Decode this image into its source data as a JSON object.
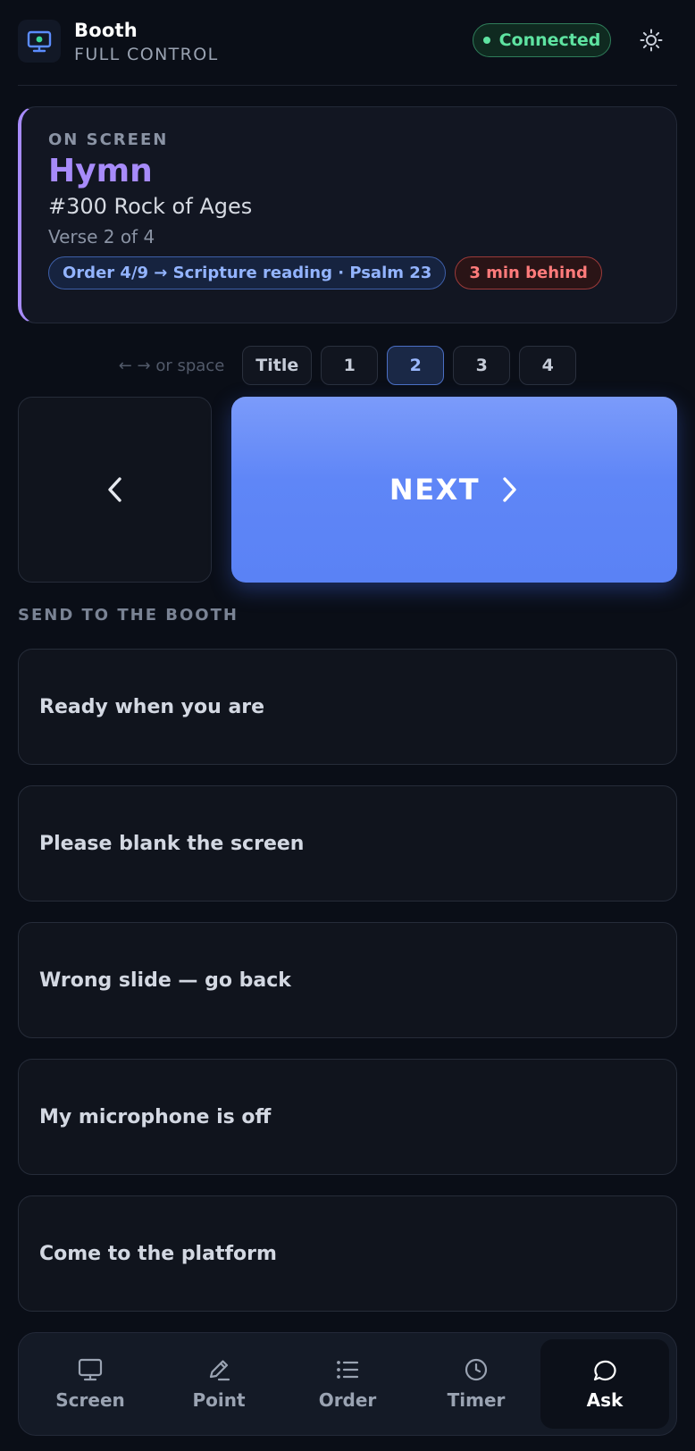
{
  "header": {
    "title": "Booth",
    "subtitle": "FULL CONTROL",
    "status": "Connected",
    "colors": {
      "status": "#5ee3a1",
      "accent": "#a78bfa"
    }
  },
  "on_screen": {
    "kicker": "ON SCREEN",
    "type": "Hymn",
    "song": "#300 Rock of Ages",
    "verse": "Verse 2 of 4",
    "order_tag": "Order 4/9 → Scripture reading · Psalm 23",
    "behind_tag": "3 min behind"
  },
  "verse_nav": {
    "hint": "← → or space",
    "items": [
      "Title",
      "1",
      "2",
      "3",
      "4"
    ],
    "active": "2"
  },
  "controls": {
    "next_label": "NEXT",
    "prev_icon": "chevron-left-icon",
    "next_icon": "chevron-right-icon"
  },
  "send_to_booth": {
    "label": "SEND TO THE BOOTH",
    "messages": [
      "Ready when you are",
      "Please blank the screen",
      "Wrong slide — go back",
      "My microphone is off",
      "Come to the platform"
    ]
  },
  "bottom_nav": {
    "items": [
      {
        "label": "Screen",
        "icon": "monitor-icon"
      },
      {
        "label": "Point",
        "icon": "pencil-icon"
      },
      {
        "label": "Order",
        "icon": "list-icon"
      },
      {
        "label": "Timer",
        "icon": "clock-icon"
      },
      {
        "label": "Ask",
        "icon": "chat-bubble-icon"
      }
    ],
    "active": "Ask"
  }
}
